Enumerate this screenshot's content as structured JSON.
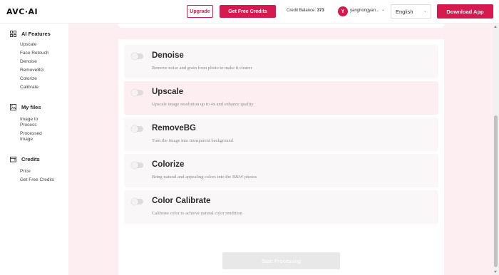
{
  "header": {
    "logo": "AVC·AI",
    "upgrade_label": "Upgrade",
    "free_credits_label": "Get Free Credits",
    "credit_balance_label": "Credit Balance:",
    "credit_balance_value": "373",
    "avatar_initial": "Y",
    "username": "yanghongyan...",
    "language": "English",
    "download_label": "Download App"
  },
  "sidebar": {
    "sections": [
      {
        "title": "AI Features",
        "icon": "grid-icon",
        "items": [
          "Upscale",
          "Face Retouch",
          "Denoise",
          "RemoveBG",
          "Colorize",
          "Calibrate"
        ]
      },
      {
        "title": "My files",
        "icon": "image-icon",
        "items": [
          "Image to Process",
          "Processed Image"
        ]
      },
      {
        "title": "Credits",
        "icon": "wallet-icon",
        "items": [
          "Price",
          "Get Free Credits"
        ]
      }
    ]
  },
  "features": [
    {
      "title": "Denoise",
      "desc": "Remove noise and grain from photo to make it clearer",
      "enabled": false,
      "active": false
    },
    {
      "title": "Upscale",
      "desc": "Upscale image resolution up to 4x and enhance quality",
      "enabled": false,
      "active": true
    },
    {
      "title": "RemoveBG",
      "desc": "Turn the image into transparent background",
      "enabled": false,
      "active": false
    },
    {
      "title": "Colorize",
      "desc": "Bring natural and appealing colors into the B&W photos",
      "enabled": false,
      "active": false
    },
    {
      "title": "Color Calibrate",
      "desc": "Calibrate color to achieve natural color rendition",
      "enabled": false,
      "active": false
    }
  ],
  "start_button_label": "Start Processing",
  "colors": {
    "accent": "#d6194f",
    "background": "#fdeef1"
  }
}
